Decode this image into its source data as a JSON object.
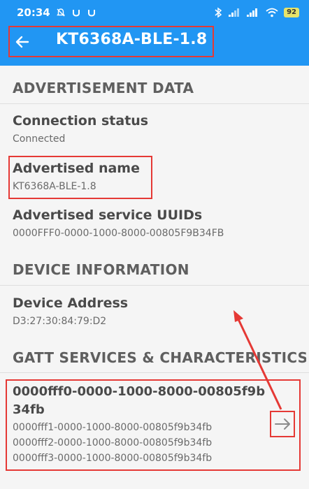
{
  "status_bar": {
    "time": "20:34",
    "battery": "92"
  },
  "app_bar": {
    "title": "KT6368A-BLE-1.8"
  },
  "advertisement": {
    "header": "ADVERTISEMENT DATA",
    "connection_status_title": "Connection status",
    "connection_status_value": "Connected",
    "advertised_name_title": "Advertised name",
    "advertised_name_value": "KT6368A-BLE-1.8",
    "service_uuids_title": "Advertised service UUIDs",
    "service_uuids_value": "0000FFF0-0000-1000-8000-00805F9B34FB"
  },
  "device_info": {
    "header": "DEVICE INFORMATION",
    "address_title": "Device Address",
    "address_value": "D3:27:30:84:79:D2"
  },
  "gatt": {
    "header": "GATT SERVICES & CHARACTERISTICS",
    "service_title_line1": "0000fff0-0000-1000-8000-00805f9b",
    "service_title_line2": "34fb",
    "characteristics": [
      "0000fff1-0000-1000-8000-00805f9b34fb",
      "0000fff2-0000-1000-8000-00805f9b34fb",
      "0000fff3-0000-1000-8000-00805f9b34fb"
    ]
  },
  "colors": {
    "primary": "#2196f3",
    "annotation": "#e53935",
    "background": "#f5f5f5"
  }
}
